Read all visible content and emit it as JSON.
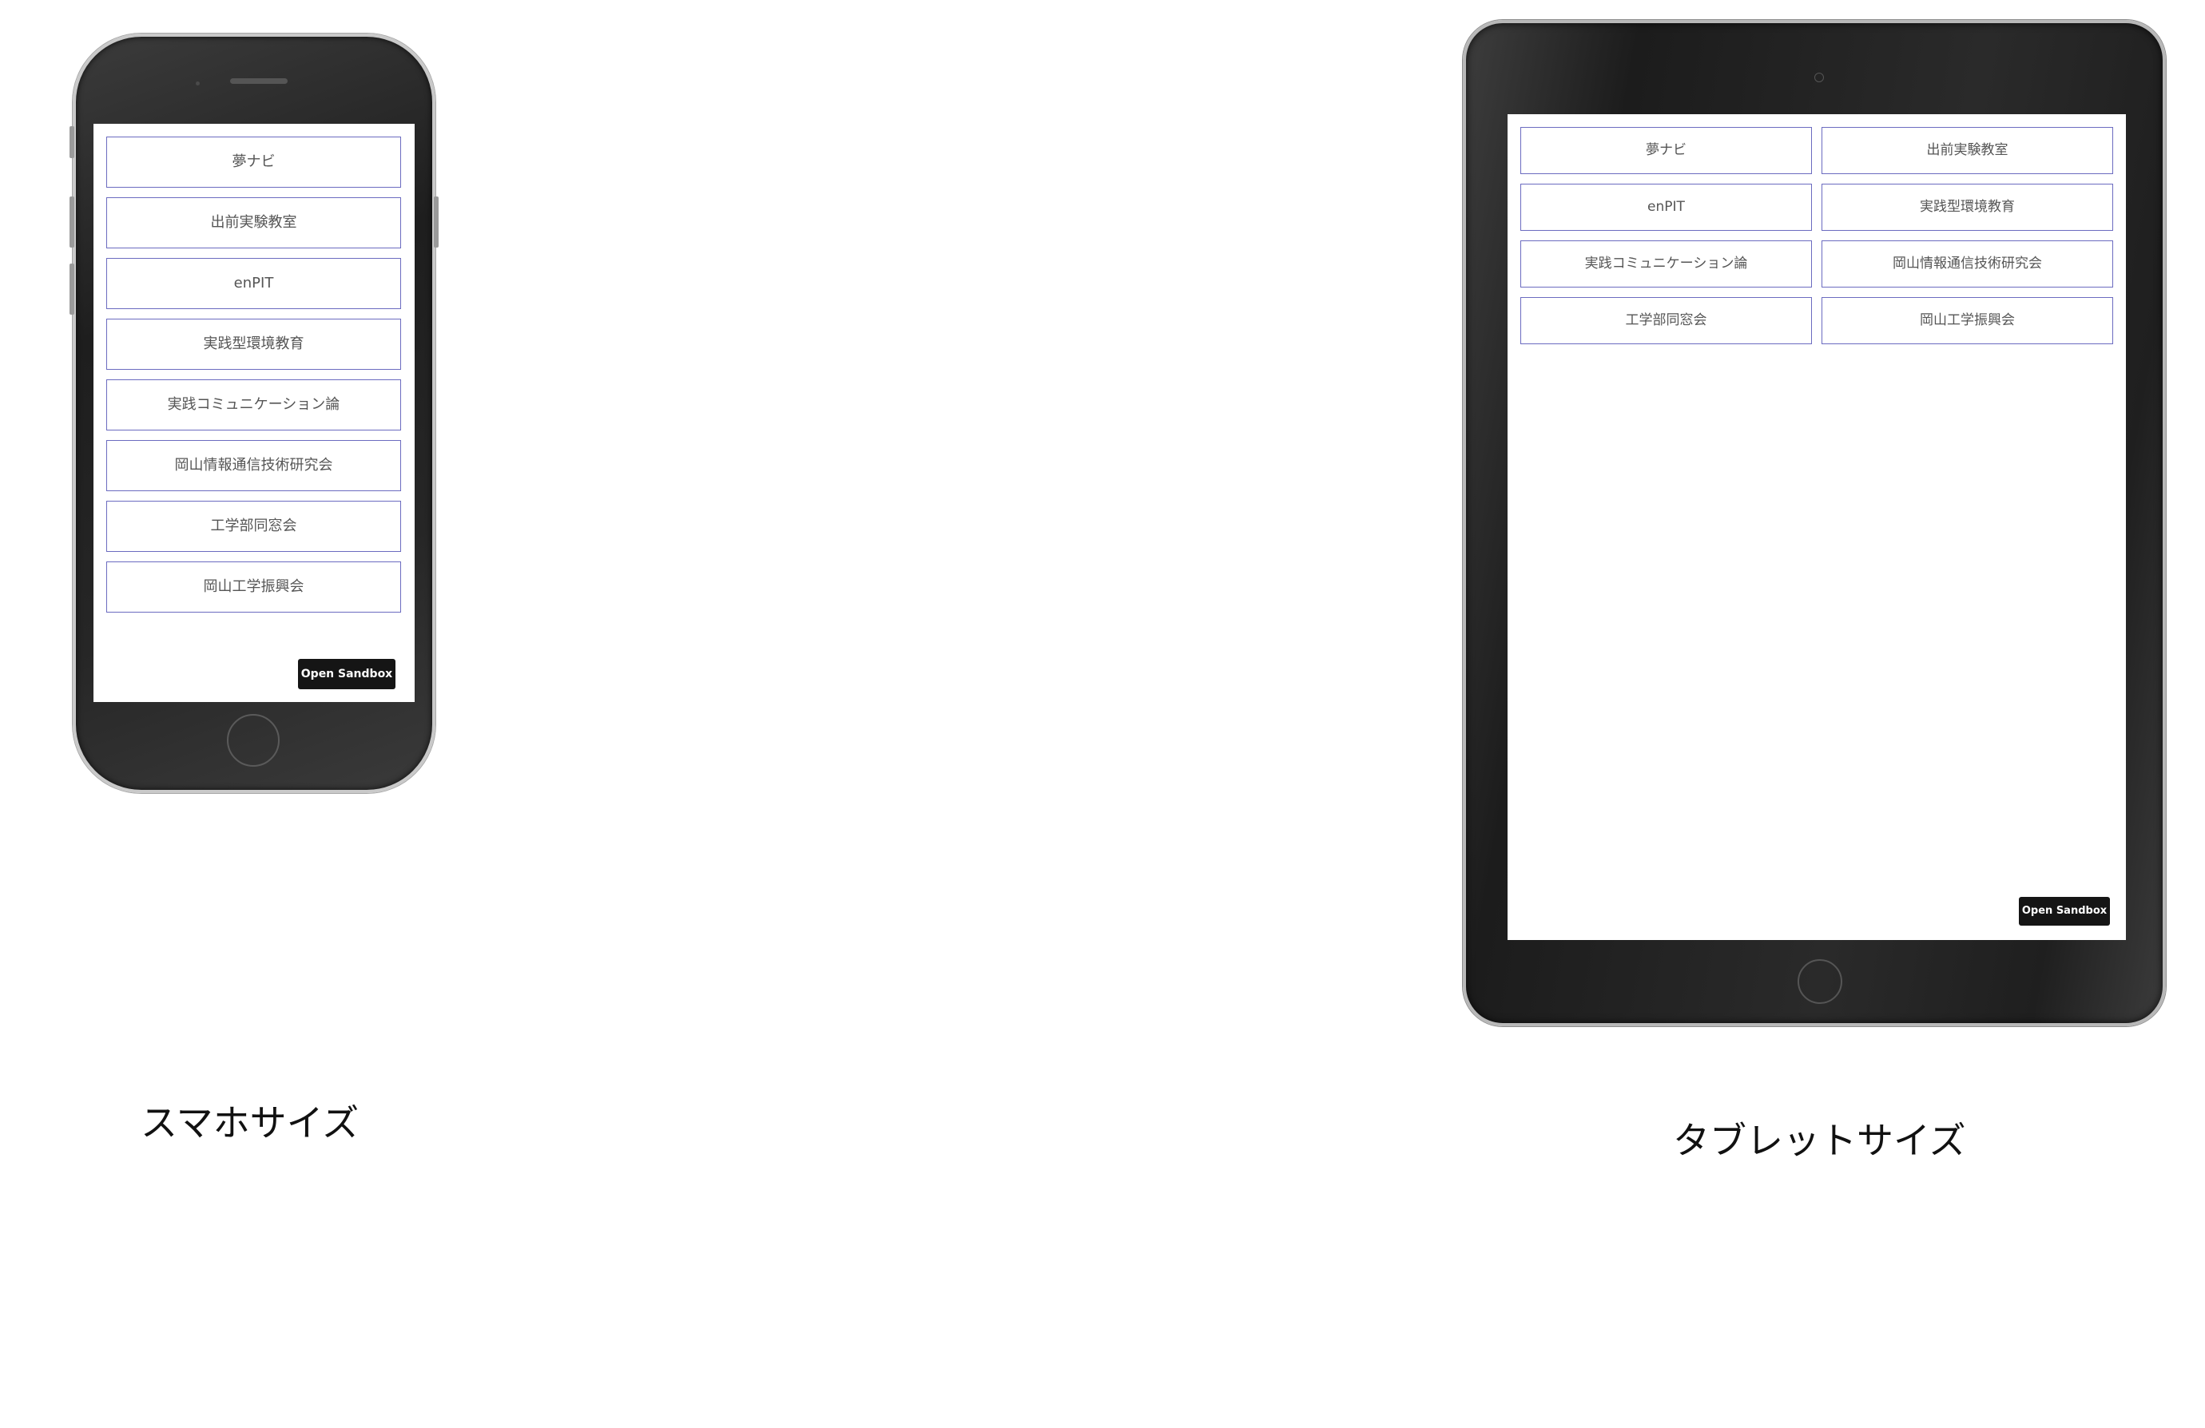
{
  "phone": {
    "links": [
      {
        "label": "夢ナビ"
      },
      {
        "label": "出前実験教室"
      },
      {
        "label": "enPIT"
      },
      {
        "label": "実践型環境教育"
      },
      {
        "label": "実践コミュニケーション論"
      },
      {
        "label": "岡山情報通信技術研究会"
      },
      {
        "label": "工学部同窓会"
      },
      {
        "label": "岡山工学振興会"
      }
    ],
    "sandbox_label": "Open Sandbox",
    "caption": "スマホサイズ"
  },
  "tablet": {
    "links": [
      {
        "label": "夢ナビ"
      },
      {
        "label": "出前実験教室"
      },
      {
        "label": "enPIT"
      },
      {
        "label": "実践型環境教育"
      },
      {
        "label": "実践コミュニケーション論"
      },
      {
        "label": "岡山情報通信技術研究会"
      },
      {
        "label": "工学部同窓会"
      },
      {
        "label": "岡山工学振興会"
      }
    ],
    "sandbox_label": "Open Sandbox",
    "caption": "タブレットサイズ"
  },
  "colors": {
    "button_border": "#6b6bc0",
    "device_frame": "#1e1e1e",
    "sandbox_button": "#151515"
  }
}
